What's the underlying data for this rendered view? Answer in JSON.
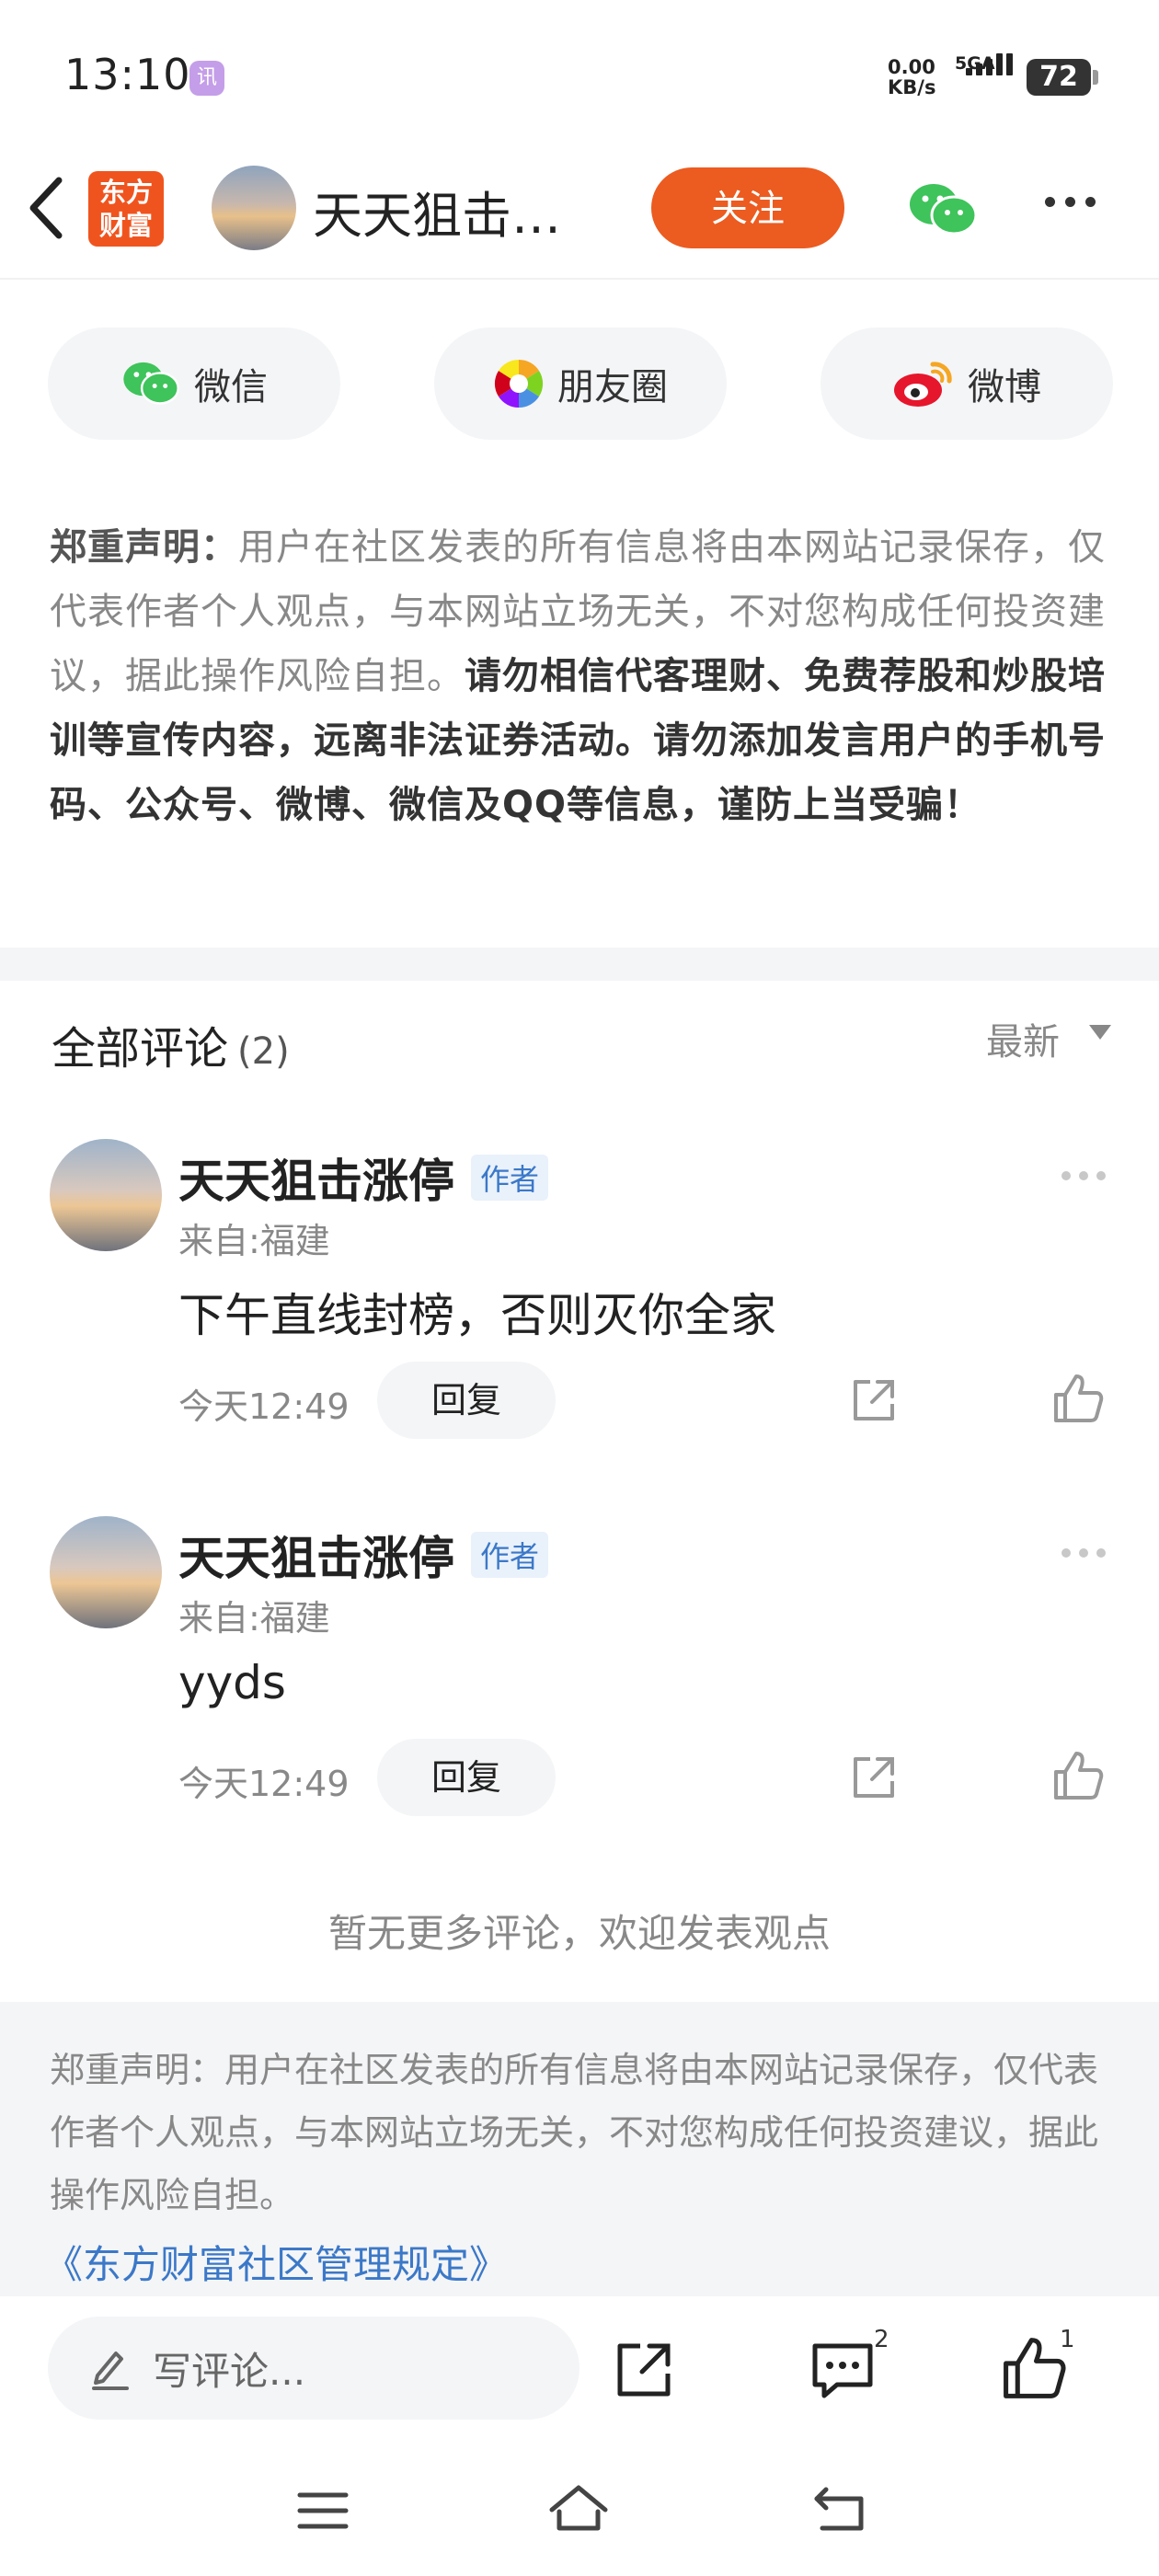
{
  "status_bar": {
    "time": "13:10",
    "app_badge": "讯",
    "net_speed_value": "0.00",
    "net_speed_unit": "KB/s",
    "network": "5GA",
    "battery": "72"
  },
  "header": {
    "logo_line1": "东方",
    "logo_line2": "财富",
    "title": "天天狙击…",
    "follow_label": "关注"
  },
  "share": {
    "wechat": "微信",
    "moments": "朋友圈",
    "weibo": "微博"
  },
  "disclaimer": {
    "label": "郑重声明：",
    "normal": "用户在社区发表的所有信息将由本网站记录保存，仅代表作者个人观点，与本网站立场无关，不对您构成任何投资建议，据此操作风险自担。",
    "bold": "请勿相信代客理财、免费荐股和炒股培训等宣传内容，远离非法证券活动。请勿添加发言用户的手机号码、公众号、微博、微信及QQ等信息，谨防上当受骗！"
  },
  "comments_header": {
    "title": "全部评论",
    "count": "(2)",
    "sort": "最新"
  },
  "comments": [
    {
      "author": "天天狙击涨停",
      "badge": "作者",
      "location": "来自:福建",
      "text": "下午直线封榜，否则灭你全家",
      "time": "今天12:49",
      "reply_label": "回复"
    },
    {
      "author": "天天狙击涨停",
      "badge": "作者",
      "location": "来自:福建",
      "text": "yyds",
      "time": "今天12:49",
      "reply_label": "回复"
    }
  ],
  "no_more_text": "暂无更多评论，欢迎发表观点",
  "footer_notice": {
    "text": "郑重声明：用户在社区发表的所有信息将由本网站记录保存，仅代表作者个人观点，与本网站立场无关，不对您构成任何投资建议，据此操作风险自担。",
    "link": "《东方财富社区管理规定》"
  },
  "bottom_bar": {
    "comment_placeholder": "写评论...",
    "comment_count": "2",
    "like_count": "1"
  },
  "colors": {
    "accent_orange": "#ec5b20",
    "link_blue": "#3b78c8",
    "gray_bg": "#f4f5f7"
  }
}
